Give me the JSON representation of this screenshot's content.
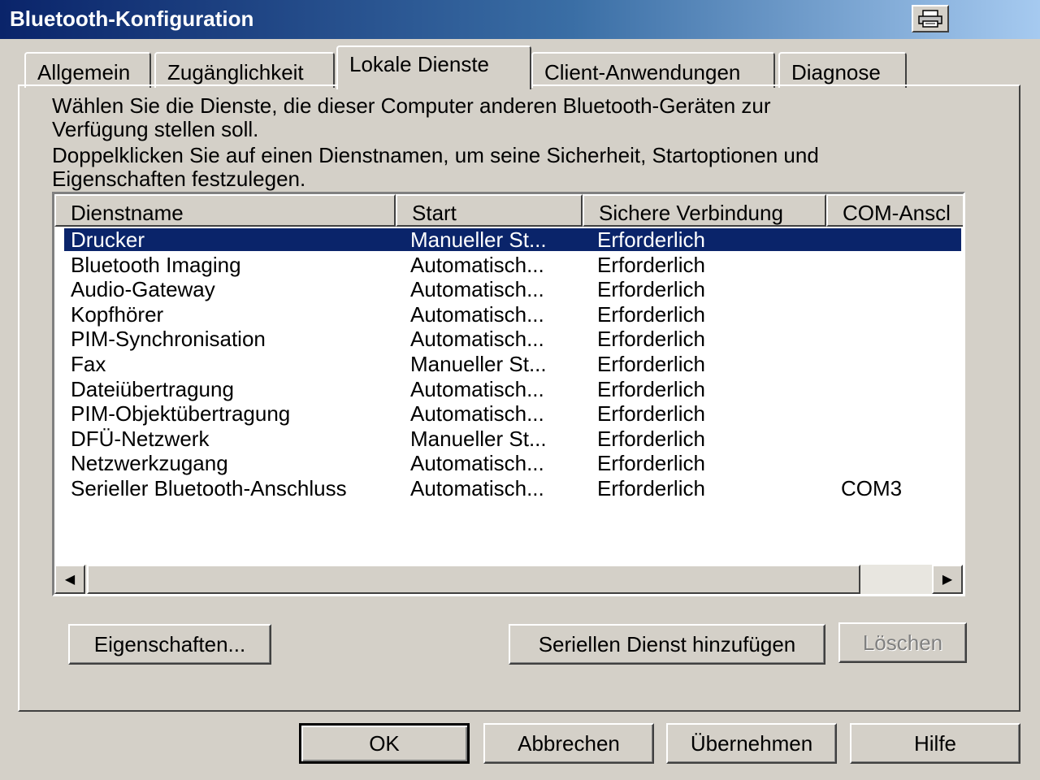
{
  "window": {
    "title": "Bluetooth-Konfiguration"
  },
  "tabs": [
    {
      "label": "Allgemein"
    },
    {
      "label": "Zugänglichkeit"
    },
    {
      "label": "Lokale Dienste"
    },
    {
      "label": "Client-Anwendungen"
    },
    {
      "label": "Diagnose"
    }
  ],
  "description": {
    "line1": "Wählen Sie die Dienste, die dieser Computer anderen Bluetooth-Geräten zur",
    "line2": "Verfügung stellen soll.",
    "line3": "Doppelklicken Sie auf einen Dienstnamen, um seine Sicherheit, Startoptionen und",
    "line4": "Eigenschaften festzulegen."
  },
  "table": {
    "columns": [
      "Dienstname",
      "Start",
      "Sichere Verbindung",
      "COM-Anscl"
    ],
    "rows": [
      {
        "name": "Drucker",
        "start": "Manueller St...",
        "secure": "Erforderlich",
        "com": ""
      },
      {
        "name": "Bluetooth Imaging",
        "start": "Automatisch...",
        "secure": "Erforderlich",
        "com": ""
      },
      {
        "name": "Audio-Gateway",
        "start": "Automatisch...",
        "secure": "Erforderlich",
        "com": ""
      },
      {
        "name": "Kopfhörer",
        "start": "Automatisch...",
        "secure": "Erforderlich",
        "com": ""
      },
      {
        "name": "PIM-Synchronisation",
        "start": "Automatisch...",
        "secure": "Erforderlich",
        "com": ""
      },
      {
        "name": "Fax",
        "start": "Manueller St...",
        "secure": "Erforderlich",
        "com": ""
      },
      {
        "name": "Dateiübertragung",
        "start": "Automatisch...",
        "secure": "Erforderlich",
        "com": ""
      },
      {
        "name": "PIM-Objektübertragung",
        "start": "Automatisch...",
        "secure": "Erforderlich",
        "com": ""
      },
      {
        "name": "DFÜ-Netzwerk",
        "start": "Manueller St...",
        "secure": "Erforderlich",
        "com": ""
      },
      {
        "name": "Netzwerkzugang",
        "start": "Automatisch...",
        "secure": "Erforderlich",
        "com": ""
      },
      {
        "name": "Serieller Bluetooth-Anschluss",
        "start": "Automatisch...",
        "secure": "Erforderlich",
        "com": "COM3"
      }
    ]
  },
  "buttons": {
    "properties": "Eigenschaften...",
    "add_serial": "Seriellen Dienst hinzufügen",
    "delete": "Löschen",
    "ok": "OK",
    "cancel": "Abbrechen",
    "apply": "Übernehmen",
    "help": "Hilfe"
  },
  "icons": {
    "title_button": "printer-icon",
    "scroll_left": "arrow-left-icon",
    "scroll_right": "arrow-right-icon"
  },
  "colors": {
    "selection": "#0a246a",
    "titlebar_start": "#0a246a",
    "face": "#d4d0c8"
  }
}
